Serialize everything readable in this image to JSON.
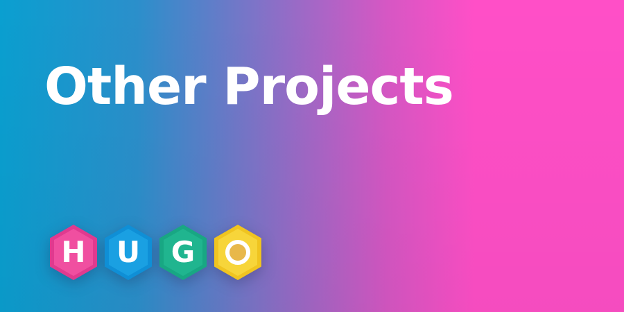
{
  "title": "Other Projects",
  "logo": {
    "letters": [
      "H",
      "U",
      "G",
      "O"
    ],
    "colors": {
      "h": "#e03a8f",
      "u": "#0f8fd6",
      "g": "#18a783",
      "o": "#f0c420",
      "o_center": "#e8b84a"
    }
  },
  "background": {
    "gradient_start": "#0a9fd0",
    "gradient_end": "#ff4fc7"
  }
}
